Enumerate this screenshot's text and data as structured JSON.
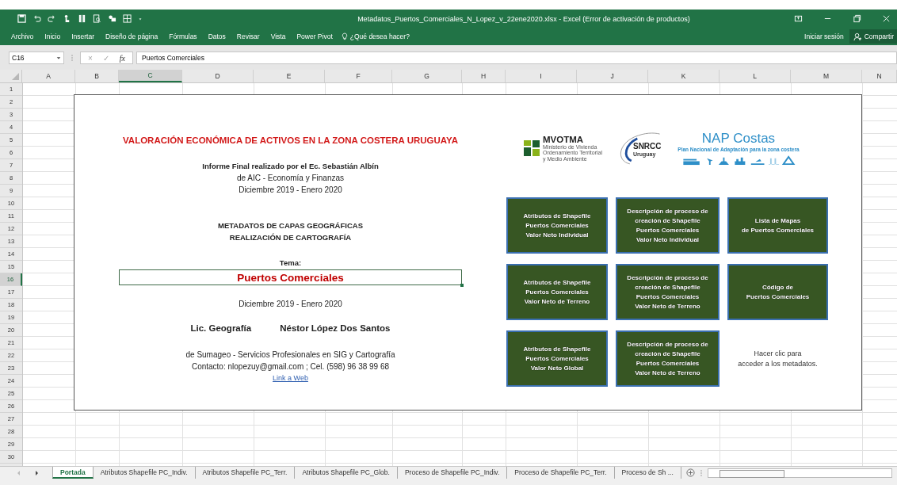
{
  "window": {
    "title": "Metadatos_Puertos_Comerciales_N_Lopez_v_22ene2020.xlsx - Excel (Error de activación de productos)"
  },
  "ribbon_tabs": [
    {
      "label": "Archivo"
    },
    {
      "label": "Inicio"
    },
    {
      "label": "Insertar"
    },
    {
      "label": "Diseño de página"
    },
    {
      "label": "Fórmulas"
    },
    {
      "label": "Datos"
    },
    {
      "label": "Revisar"
    },
    {
      "label": "Vista"
    },
    {
      "label": "Power Pivot"
    }
  ],
  "tell_me": {
    "placeholder": "¿Qué desea hacer?"
  },
  "account": {
    "sign_in": "Iniciar sesión",
    "share": "Compartir"
  },
  "formula_bar": {
    "name_box": "C16",
    "cancel": "×",
    "enter": "✓",
    "function": "fx",
    "value": "Puertos Comerciales"
  },
  "columns": [
    {
      "label": "A",
      "selected": false
    },
    {
      "label": "B",
      "selected": false
    },
    {
      "label": "C",
      "selected": true
    },
    {
      "label": "D",
      "selected": false
    },
    {
      "label": "E",
      "selected": false
    },
    {
      "label": "F",
      "selected": false
    },
    {
      "label": "G",
      "selected": false
    },
    {
      "label": "H",
      "selected": false
    },
    {
      "label": "I",
      "selected": false
    },
    {
      "label": "J",
      "selected": false
    },
    {
      "label": "K",
      "selected": false
    },
    {
      "label": "L",
      "selected": false
    },
    {
      "label": "M",
      "selected": false
    },
    {
      "label": "N",
      "selected": false
    }
  ],
  "rows": [
    {
      "label": "1",
      "selected": false
    },
    {
      "label": "2",
      "selected": false
    },
    {
      "label": "3",
      "selected": false
    },
    {
      "label": "4",
      "selected": false
    },
    {
      "label": "5",
      "selected": false
    },
    {
      "label": "6",
      "selected": false
    },
    {
      "label": "7",
      "selected": false
    },
    {
      "label": "8",
      "selected": false
    },
    {
      "label": "9",
      "selected": false
    },
    {
      "label": "10",
      "selected": false
    },
    {
      "label": "11",
      "selected": false
    },
    {
      "label": "12",
      "selected": false
    },
    {
      "label": "13",
      "selected": false
    },
    {
      "label": "14",
      "selected": false
    },
    {
      "label": "15",
      "selected": false
    },
    {
      "label": "16",
      "selected": true
    },
    {
      "label": "17",
      "selected": false
    },
    {
      "label": "18",
      "selected": false
    },
    {
      "label": "19",
      "selected": false
    },
    {
      "label": "20",
      "selected": false
    },
    {
      "label": "21",
      "selected": false
    },
    {
      "label": "22",
      "selected": false
    },
    {
      "label": "23",
      "selected": false
    },
    {
      "label": "24",
      "selected": false
    },
    {
      "label": "25",
      "selected": false
    },
    {
      "label": "26",
      "selected": false
    },
    {
      "label": "27",
      "selected": false
    },
    {
      "label": "28",
      "selected": false
    },
    {
      "label": "29",
      "selected": false
    },
    {
      "label": "30",
      "selected": false
    }
  ],
  "cover": {
    "title": "VALORACIÓN ECONÓMICA DE ACTIVOS EN LA ZONA COSTERA URUGUAYA",
    "report_lines": [
      {
        "text": "Informe Final realizado por el Ec. Sebastián Albín",
        "bold": true
      },
      {
        "text": "de AIC - Economía y Finanzas",
        "bold": false
      },
      {
        "text": "Diciembre 2019 - Enero 2020",
        "bold": false
      }
    ],
    "subtitle_lines": [
      "METADATOS DE CAPAS GEOGRÁFICAS",
      "REALIZACIÓN DE CARTOGRAFÍA"
    ],
    "topic_label": "Tema:",
    "topic": "Puertos Comerciales",
    "date": "Diciembre 2019 - Enero 2020",
    "author_title": "Lic. Geografía",
    "author": "Néstor López Dos Santos",
    "company": "de Sumageo - Servicios Profesionales en SIG y Cartografía",
    "contact": "Contacto: nlopezuy@gmail.com ; Cel. (598) 96 38 99 68",
    "link": "Link a Web"
  },
  "logos": {
    "mvotma": {
      "name": "MVOTMA",
      "subtitle": "Ministerio de Vivienda\nOrdenamiento Territorial\ny Medio Ambiente"
    },
    "snrcc": {
      "name": "SNRCC",
      "subtitle": "Uruguay"
    },
    "nap": {
      "name": "NAP Costas",
      "subtitle": "Plan Nacional de Adaptación para la zona costera"
    }
  },
  "buttons": [
    {
      "label": "Atributos de Shapefile\nPuertos Comerciales\nValor Neto Individual"
    },
    {
      "label": "Descripción de proceso de\ncreación de Shapefile\nPuertos Comerciales\nValor Neto Individual"
    },
    {
      "label": "Lista de Mapas\nde Puertos Comerciales"
    },
    {
      "label": "Atributos de Shapefile\nPuertos Comerciales\nValor Neto de Terreno"
    },
    {
      "label": "Descripción de proceso de\ncreación de Shapefile\nPuertos Comerciales\nValor Neto de Terreno"
    },
    {
      "label": "Código de\nPuertos Comerciales"
    },
    {
      "label": "Atributos de Shapefile\nPuertos Comerciales\nValor Neto Global"
    },
    {
      "label": "Descripción de proceso de\ncreación de Shapefile\nPuertos Comerciales\nValor Neto de Terreno"
    }
  ],
  "hint": "Hacer clic para\nacceder a los metadatos.",
  "sheet_tabs": [
    {
      "label": "Portada",
      "selected": true
    },
    {
      "label": "Atributos Shapefile PC_Indiv.",
      "selected": false
    },
    {
      "label": "Atributos Shapefile PC_Terr.",
      "selected": false
    },
    {
      "label": "Atributos Shapefile PC_Glob.",
      "selected": false
    },
    {
      "label": "Proceso de Shapefile PC_Indiv.",
      "selected": false
    },
    {
      "label": "Proceso de Shapefile PC_Terr.",
      "selected": false
    },
    {
      "label": "Proceso de Sh ...",
      "selected": false
    }
  ]
}
